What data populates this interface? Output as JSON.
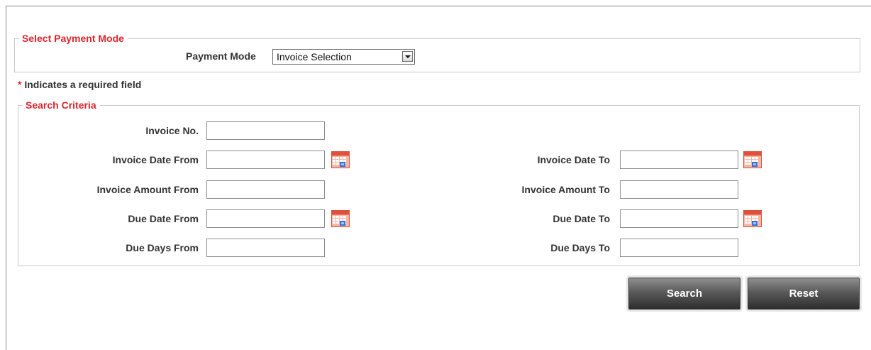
{
  "payment_mode_section": {
    "legend": "Select Payment Mode",
    "label": "Payment Mode",
    "selected_value": "Invoice Selection"
  },
  "required_note": {
    "star": "*",
    "text": "Indicates a required field"
  },
  "search_criteria": {
    "legend": "Search Criteria",
    "invoice_no": {
      "label": "Invoice No.",
      "value": ""
    },
    "invoice_date_from": {
      "label": "Invoice Date From",
      "value": ""
    },
    "invoice_date_to": {
      "label": "Invoice Date To",
      "value": ""
    },
    "invoice_amount_from": {
      "label": "Invoice Amount From",
      "value": ""
    },
    "invoice_amount_to": {
      "label": "Invoice Amount To",
      "value": ""
    },
    "due_date_from": {
      "label": "Due Date From",
      "value": ""
    },
    "due_date_to": {
      "label": "Due Date To",
      "value": ""
    },
    "due_days_from": {
      "label": "Due Days From",
      "value": ""
    },
    "due_days_to": {
      "label": "Due Days To",
      "value": ""
    }
  },
  "actions": {
    "search_label": "Search",
    "reset_label": "Reset"
  },
  "icons": {
    "calendar": "calendar-icon",
    "dropdown": "chevron-down-icon"
  },
  "colors": {
    "accent_red": "#d9262b",
    "button_dark": "#3a3a3a",
    "border_gray": "#c8c8c8"
  }
}
